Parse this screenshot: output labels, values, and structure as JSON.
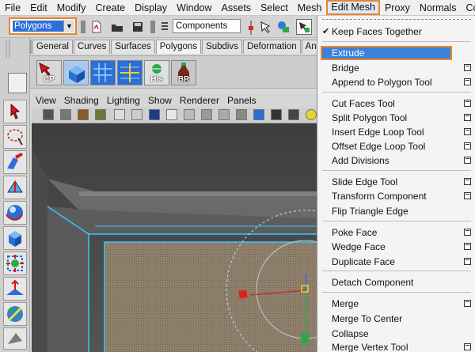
{
  "menubar": {
    "items": [
      "File",
      "Edit",
      "Modify",
      "Create",
      "Display",
      "Window",
      "Assets",
      "Select",
      "Mesh",
      "Edit Mesh",
      "Proxy",
      "Normals",
      "Color"
    ],
    "active_index": 9
  },
  "statusline": {
    "mode_value": "Polygons",
    "component_label": "Components"
  },
  "shelf": {
    "tabs": [
      "General",
      "Curves",
      "Surfaces",
      "Polygons",
      "Subdivs",
      "Deformation",
      "Animation"
    ],
    "buttons": [
      "CP",
      "",
      "",
      "",
      "His",
      "BR"
    ]
  },
  "panel": {
    "menu": [
      "View",
      "Shading",
      "Lighting",
      "Show",
      "Renderer",
      "Panels"
    ]
  },
  "dropdown": {
    "items": [
      {
        "label": "Keep Faces Together",
        "checked": true,
        "option": false
      },
      {
        "label": "Extrude",
        "checked": false,
        "option": true,
        "highlighted": true
      },
      {
        "label": "Bridge",
        "checked": false,
        "option": true
      },
      {
        "label": "Append to Polygon Tool",
        "checked": false,
        "option": true
      },
      {
        "label": "Cut Faces Tool",
        "checked": false,
        "option": true
      },
      {
        "label": "Split Polygon Tool",
        "checked": false,
        "option": true
      },
      {
        "label": "Insert Edge Loop Tool",
        "checked": false,
        "option": true
      },
      {
        "label": "Offset Edge Loop Tool",
        "checked": false,
        "option": true
      },
      {
        "label": "Add Divisions",
        "checked": false,
        "option": true
      },
      {
        "label": "Slide Edge Tool",
        "checked": false,
        "option": true
      },
      {
        "label": "Transform Component",
        "checked": false,
        "option": true
      },
      {
        "label": "Flip Triangle Edge",
        "checked": false,
        "option": false
      },
      {
        "label": "Poke Face",
        "checked": false,
        "option": true
      },
      {
        "label": "Wedge Face",
        "checked": false,
        "option": true
      },
      {
        "label": "Duplicate Face",
        "checked": false,
        "option": true
      },
      {
        "label": "Detach Component",
        "checked": false,
        "option": false
      },
      {
        "label": "Merge",
        "checked": false,
        "option": true
      },
      {
        "label": "Merge To Center",
        "checked": false,
        "option": false
      },
      {
        "label": "Collapse",
        "checked": false,
        "option": false
      },
      {
        "label": "Merge Vertex Tool",
        "checked": false,
        "option": true
      }
    ]
  },
  "colors": {
    "highlight": "#3c82dc",
    "callout": "#e8862a",
    "selection_blue": "#2f6fd6"
  }
}
